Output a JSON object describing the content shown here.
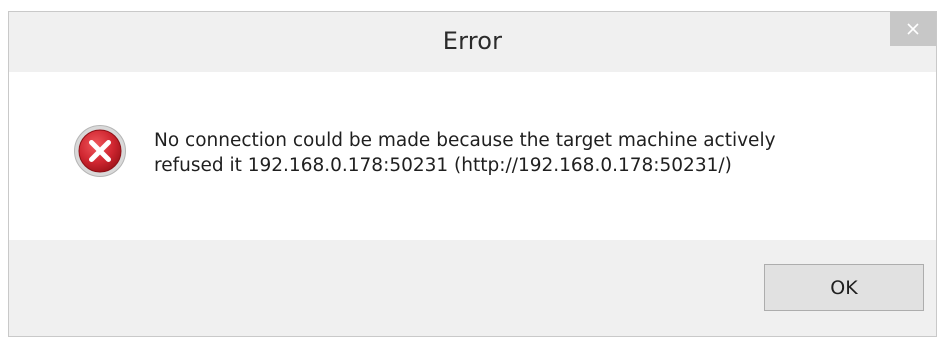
{
  "dialog": {
    "title": "Error",
    "message_line1": "No connection could be made because the target machine actively",
    "message_line2": "refused it 192.168.0.178:50231 (http://192.168.0.178:50231/)",
    "ok_label": "OK",
    "close_icon": "close-icon",
    "status_icon": "error-icon"
  },
  "colors": {
    "titlebar": "#f0f0f0",
    "close_button": "#c7c7c7",
    "content_bg": "#ffffff",
    "footer_bg": "#f0f0f0",
    "error_red": "#c8202a"
  }
}
